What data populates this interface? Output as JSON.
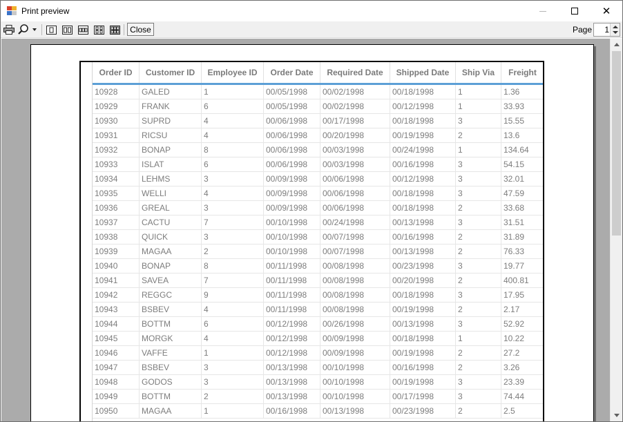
{
  "window": {
    "title": "Print preview",
    "close_glyph": "✕"
  },
  "toolbar": {
    "close_label": "Close",
    "page_label": "Page",
    "page_value": "1"
  },
  "icons": [
    "app-icon",
    "print-icon",
    "zoom-icon",
    "one-page-icon",
    "two-pages-icon",
    "three-pages-icon",
    "four-pages-icon",
    "six-pages-icon"
  ],
  "table": {
    "columns": [
      "Order ID",
      "Customer ID",
      "Employee ID",
      "Order Date",
      "Required Date",
      "Shipped Date",
      "Ship Via",
      "Freight"
    ],
    "rows": [
      [
        "10928",
        "GALED",
        "1",
        "00/05/1998",
        "00/02/1998",
        "00/18/1998",
        "1",
        "1.36"
      ],
      [
        "10929",
        "FRANK",
        "6",
        "00/05/1998",
        "00/02/1998",
        "00/12/1998",
        "1",
        "33.93"
      ],
      [
        "10930",
        "SUPRD",
        "4",
        "00/06/1998",
        "00/17/1998",
        "00/18/1998",
        "3",
        "15.55"
      ],
      [
        "10931",
        "RICSU",
        "4",
        "00/06/1998",
        "00/20/1998",
        "00/19/1998",
        "2",
        "13.6"
      ],
      [
        "10932",
        "BONAP",
        "8",
        "00/06/1998",
        "00/03/1998",
        "00/24/1998",
        "1",
        "134.64"
      ],
      [
        "10933",
        "ISLAT",
        "6",
        "00/06/1998",
        "00/03/1998",
        "00/16/1998",
        "3",
        "54.15"
      ],
      [
        "10934",
        "LEHMS",
        "3",
        "00/09/1998",
        "00/06/1998",
        "00/12/1998",
        "3",
        "32.01"
      ],
      [
        "10935",
        "WELLI",
        "4",
        "00/09/1998",
        "00/06/1998",
        "00/18/1998",
        "3",
        "47.59"
      ],
      [
        "10936",
        "GREAL",
        "3",
        "00/09/1998",
        "00/06/1998",
        "00/18/1998",
        "2",
        "33.68"
      ],
      [
        "10937",
        "CACTU",
        "7",
        "00/10/1998",
        "00/24/1998",
        "00/13/1998",
        "3",
        "31.51"
      ],
      [
        "10938",
        "QUICK",
        "3",
        "00/10/1998",
        "00/07/1998",
        "00/16/1998",
        "2",
        "31.89"
      ],
      [
        "10939",
        "MAGAA",
        "2",
        "00/10/1998",
        "00/07/1998",
        "00/13/1998",
        "2",
        "76.33"
      ],
      [
        "10940",
        "BONAP",
        "8",
        "00/11/1998",
        "00/08/1998",
        "00/23/1998",
        "3",
        "19.77"
      ],
      [
        "10941",
        "SAVEA",
        "7",
        "00/11/1998",
        "00/08/1998",
        "00/20/1998",
        "2",
        "400.81"
      ],
      [
        "10942",
        "REGGC",
        "9",
        "00/11/1998",
        "00/08/1998",
        "00/18/1998",
        "3",
        "17.95"
      ],
      [
        "10943",
        "BSBEV",
        "4",
        "00/11/1998",
        "00/08/1998",
        "00/19/1998",
        "2",
        "2.17"
      ],
      [
        "10944",
        "BOTTM",
        "6",
        "00/12/1998",
        "00/26/1998",
        "00/13/1998",
        "3",
        "52.92"
      ],
      [
        "10945",
        "MORGK",
        "4",
        "00/12/1998",
        "00/09/1998",
        "00/18/1998",
        "1",
        "10.22"
      ],
      [
        "10946",
        "VAFFE",
        "1",
        "00/12/1998",
        "00/09/1998",
        "00/19/1998",
        "2",
        "27.2"
      ],
      [
        "10947",
        "BSBEV",
        "3",
        "00/13/1998",
        "00/10/1998",
        "00/16/1998",
        "2",
        "3.26"
      ],
      [
        "10948",
        "GODOS",
        "3",
        "00/13/1998",
        "00/10/1998",
        "00/19/1998",
        "3",
        "23.39"
      ],
      [
        "10949",
        "BOTTM",
        "2",
        "00/13/1998",
        "00/10/1998",
        "00/17/1998",
        "3",
        "74.44"
      ],
      [
        "10950",
        "MAGAA",
        "1",
        "00/16/1998",
        "00/13/1998",
        "00/23/1998",
        "2",
        "2.5"
      ]
    ]
  },
  "colors": {
    "header_underline": "#5c9fd6",
    "preview_background": "#ababab",
    "cell_text": "#7d7d7d",
    "header_text": "#7a7a7a"
  }
}
